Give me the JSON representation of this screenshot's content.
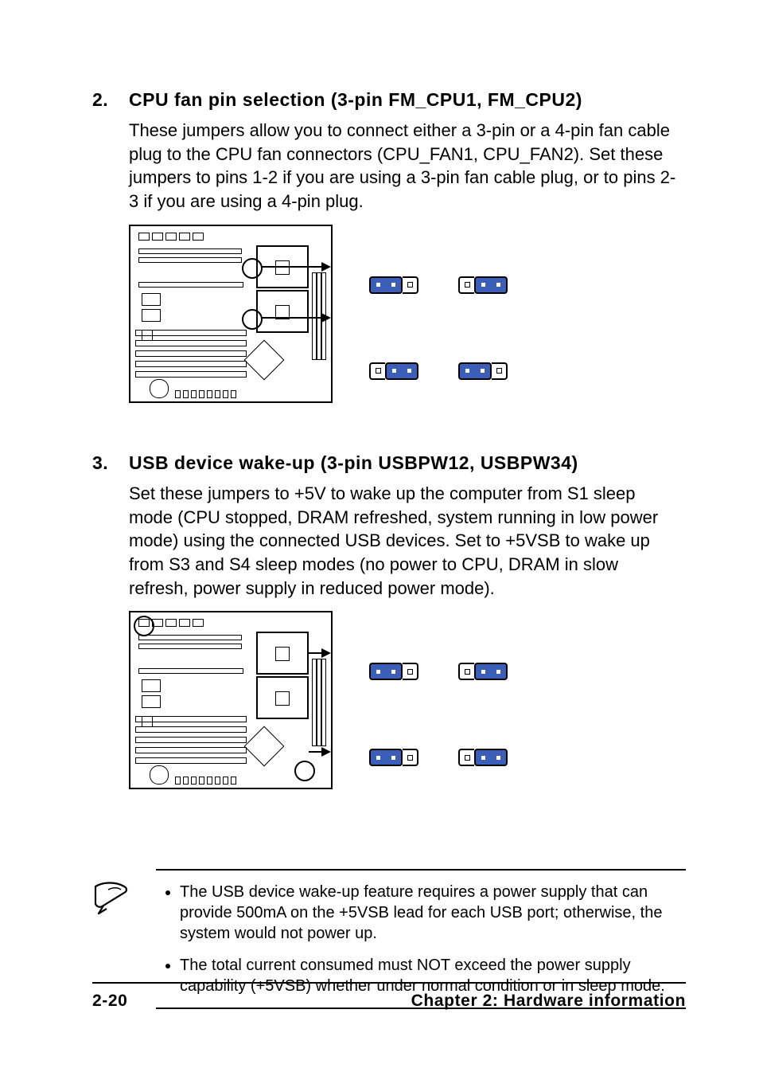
{
  "sections": [
    {
      "number": "2.",
      "title": "CPU fan pin selection (3-pin FM_CPU1, FM_CPU2)",
      "body": "These jumpers allow you to connect either a 3-pin or a 4-pin fan cable plug to the CPU fan connectors (CPU_FAN1, CPU_FAN2). Set these jumpers to pins 1-2 if you are using a 3-pin fan cable plug, or to pins 2-3 if you are using a 4-pin plug."
    },
    {
      "number": "3.",
      "title": "USB device wake-up (3-pin USBPW12, USBPW34)",
      "body": "Set these jumpers to +5V to wake up the computer from S1 sleep mode (CPU stopped, DRAM refreshed, system running in low power mode) using the connected USB devices. Set to +5VSB to wake up from S3 and S4 sleep modes (no power to CPU, DRAM in slow refresh, power supply in reduced power mode)."
    }
  ],
  "notes": [
    "The USB device wake-up feature requires a power supply that can provide 500mA on the +5VSB lead for each USB port; otherwise, the system would not power up.",
    "The total current consumed must NOT exceed the power supply capability (+5VSB) whether under normal condition or in sleep mode."
  ],
  "footer": {
    "page": "2-20",
    "chapter": "Chapter 2: Hardware information"
  },
  "colors": {
    "jumper_cap": "#3b5fb8"
  }
}
